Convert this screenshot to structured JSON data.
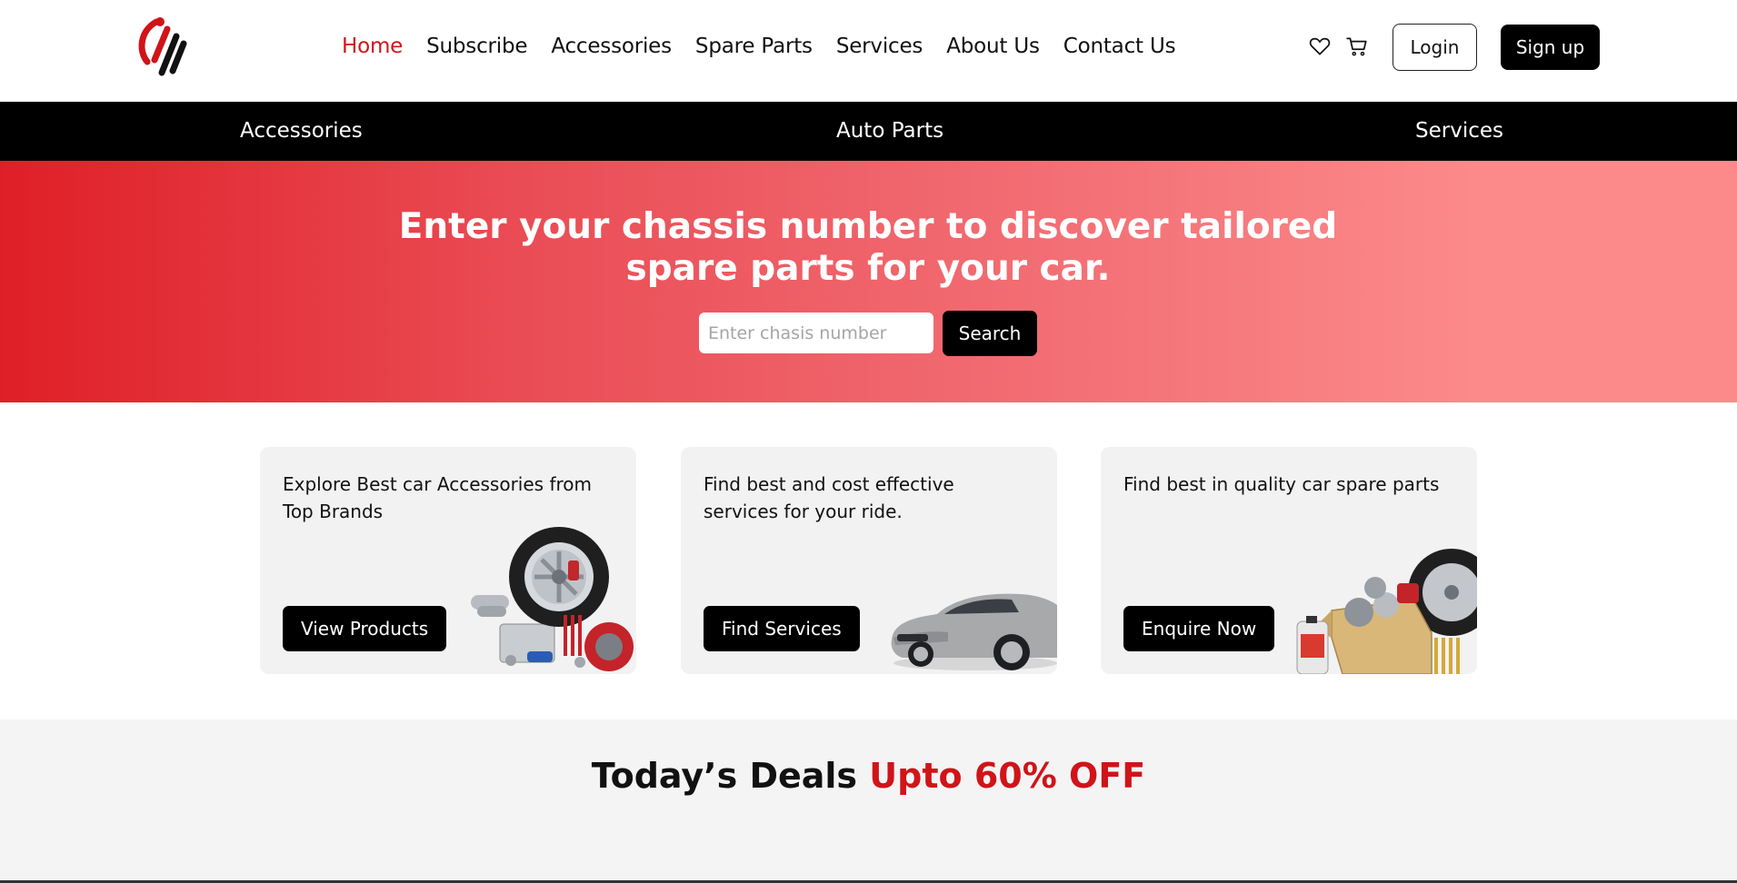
{
  "header": {
    "nav": [
      "Home",
      "Subscribe",
      "Accessories",
      "Spare Parts",
      "Services",
      "About Us",
      "Contact Us"
    ],
    "active_nav": "Home",
    "login_label": "Login",
    "signup_label": "Sign up",
    "icons": [
      "logo",
      "heart-icon",
      "cart-icon"
    ]
  },
  "category_bar": [
    "Accessories",
    "Auto Parts",
    "Services"
  ],
  "hero": {
    "title": "Enter your chassis number to discover tailored spare parts for your car.",
    "input_placeholder": "Enter chasis number",
    "search_label": "Search"
  },
  "cards": [
    {
      "text": "Explore Best car Accessories from Top Brands",
      "button": "View Products"
    },
    {
      "text": "Find best and cost effective services for your ride.",
      "button": "Find Services"
    },
    {
      "text": "Find best in quality car spare parts",
      "button": "Enquire Now"
    }
  ],
  "deals": {
    "title_part1": "Today’s Deals ",
    "title_part2": "Upto 60% OFF"
  },
  "colors": {
    "accent": "#d01418",
    "hero_gradient_start": "#df1f27",
    "hero_gradient_end": "#fc8a8a",
    "dark": "#000000"
  }
}
